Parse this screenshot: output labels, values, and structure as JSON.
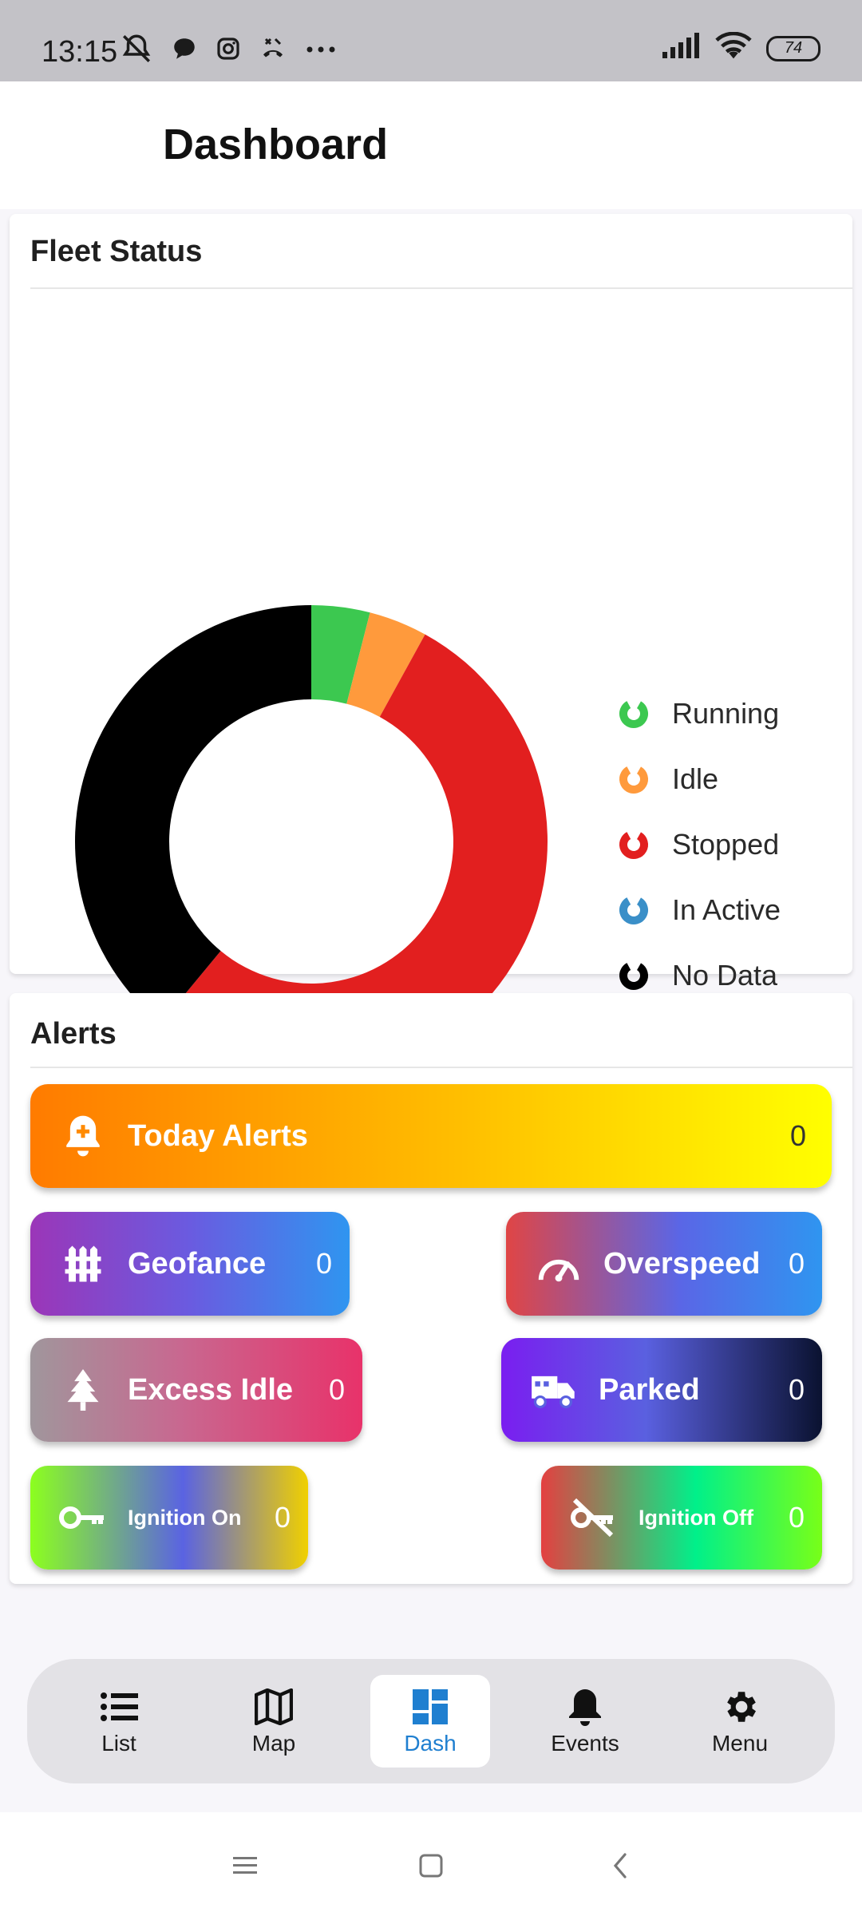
{
  "status_bar": {
    "time": "13:15",
    "battery": "74",
    "icons": [
      "mute-alarm-icon",
      "chat-icon",
      "instagram-icon",
      "call-icon",
      "more-icon",
      "signal-icon",
      "wifi-icon",
      "battery-icon"
    ]
  },
  "header": {
    "title": "Dashboard"
  },
  "fleet_status": {
    "title": "Fleet Status",
    "legend": [
      {
        "label": "Running",
        "color": "#3cc850"
      },
      {
        "label": "Idle",
        "color": "#ff9a3c"
      },
      {
        "label": "Stopped",
        "color": "#e21f1f"
      },
      {
        "label": "In Active",
        "color": "#3a8fc8"
      },
      {
        "label": "No Data",
        "color": "#000000"
      }
    ]
  },
  "chart_data": {
    "type": "pie",
    "donut": true,
    "categories": [
      "Running",
      "Idle",
      "Stopped",
      "In Active",
      "No Data"
    ],
    "values": [
      4,
      4,
      53,
      0,
      39
    ],
    "colors": [
      "#3cc850",
      "#ff9a3c",
      "#e21f1f",
      "#3a8fc8",
      "#000000"
    ],
    "legend": "right"
  },
  "alerts": {
    "title": "Alerts",
    "today": {
      "label": "Today Alerts",
      "count": "0",
      "icon": "bell-plus-icon"
    },
    "geofance": {
      "label": "Geofance",
      "count": "0",
      "icon": "fence-icon"
    },
    "overspeed": {
      "label": "Overspeed",
      "count": "0",
      "icon": "speedometer-icon"
    },
    "excess_idle": {
      "label": "Excess Idle",
      "count": "0",
      "icon": "tree-icon"
    },
    "parked": {
      "label": "Parked",
      "count": "0",
      "icon": "truck-icon"
    },
    "ignition_on": {
      "label": "Ignition On",
      "count": "0",
      "icon": "key-icon"
    },
    "ignition_off": {
      "label": "Ignition Off",
      "count": "0",
      "icon": "key-off-icon"
    }
  },
  "bottom_nav": {
    "items": [
      {
        "label": "List",
        "icon": "list-icon"
      },
      {
        "label": "Map",
        "icon": "map-icon"
      },
      {
        "label": "Dash",
        "icon": "dashboard-icon",
        "active": true
      },
      {
        "label": "Events",
        "icon": "bell-icon"
      },
      {
        "label": "Menu",
        "icon": "gear-icon"
      }
    ]
  },
  "colors": {
    "accent": "#1f7fd0"
  }
}
